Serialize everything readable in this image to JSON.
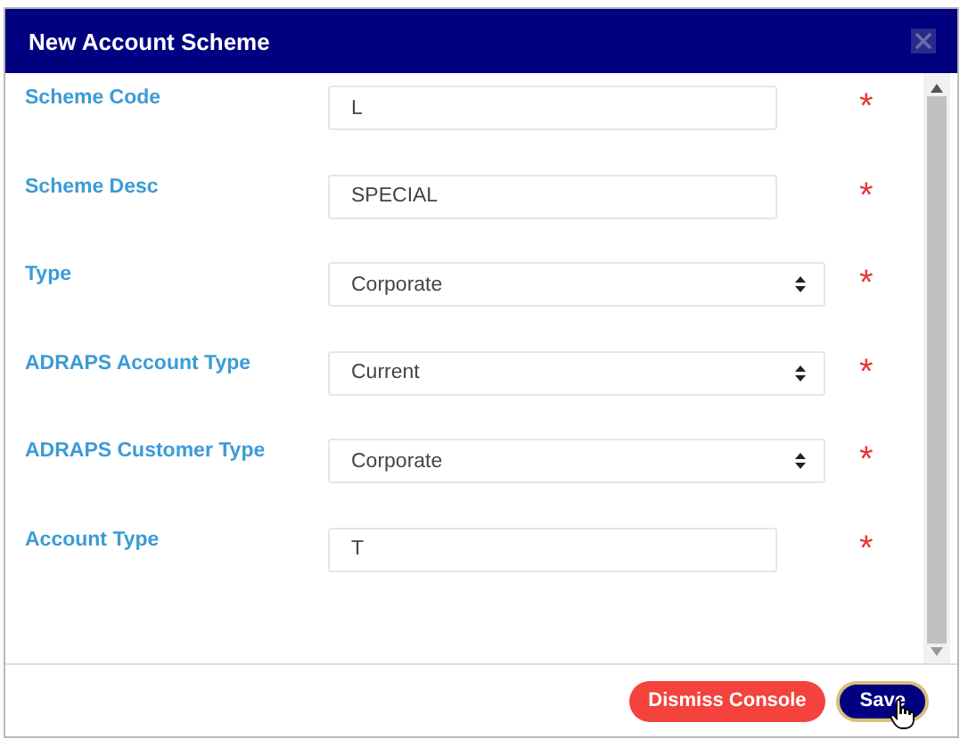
{
  "dialog": {
    "title": "New Account Scheme"
  },
  "fields": [
    {
      "label": "Scheme Code",
      "kind": "text",
      "value": "L",
      "required": true
    },
    {
      "label": "Scheme Desc",
      "kind": "text",
      "value": "SPECIAL",
      "required": true
    },
    {
      "label": "Type",
      "kind": "select",
      "value": "Corporate",
      "required": true
    },
    {
      "label": "ADRAPS Account Type",
      "kind": "select",
      "value": "Current",
      "required": true
    },
    {
      "label": "ADRAPS Customer Type",
      "kind": "select",
      "value": "Corporate",
      "required": true
    },
    {
      "label": "Account Type",
      "kind": "text",
      "value": "T",
      "required": true
    }
  ],
  "required_mark": "*",
  "buttons": [
    {
      "label": "Dismiss Console",
      "kind": "danger"
    },
    {
      "label": "Save",
      "kind": "primary"
    }
  ]
}
